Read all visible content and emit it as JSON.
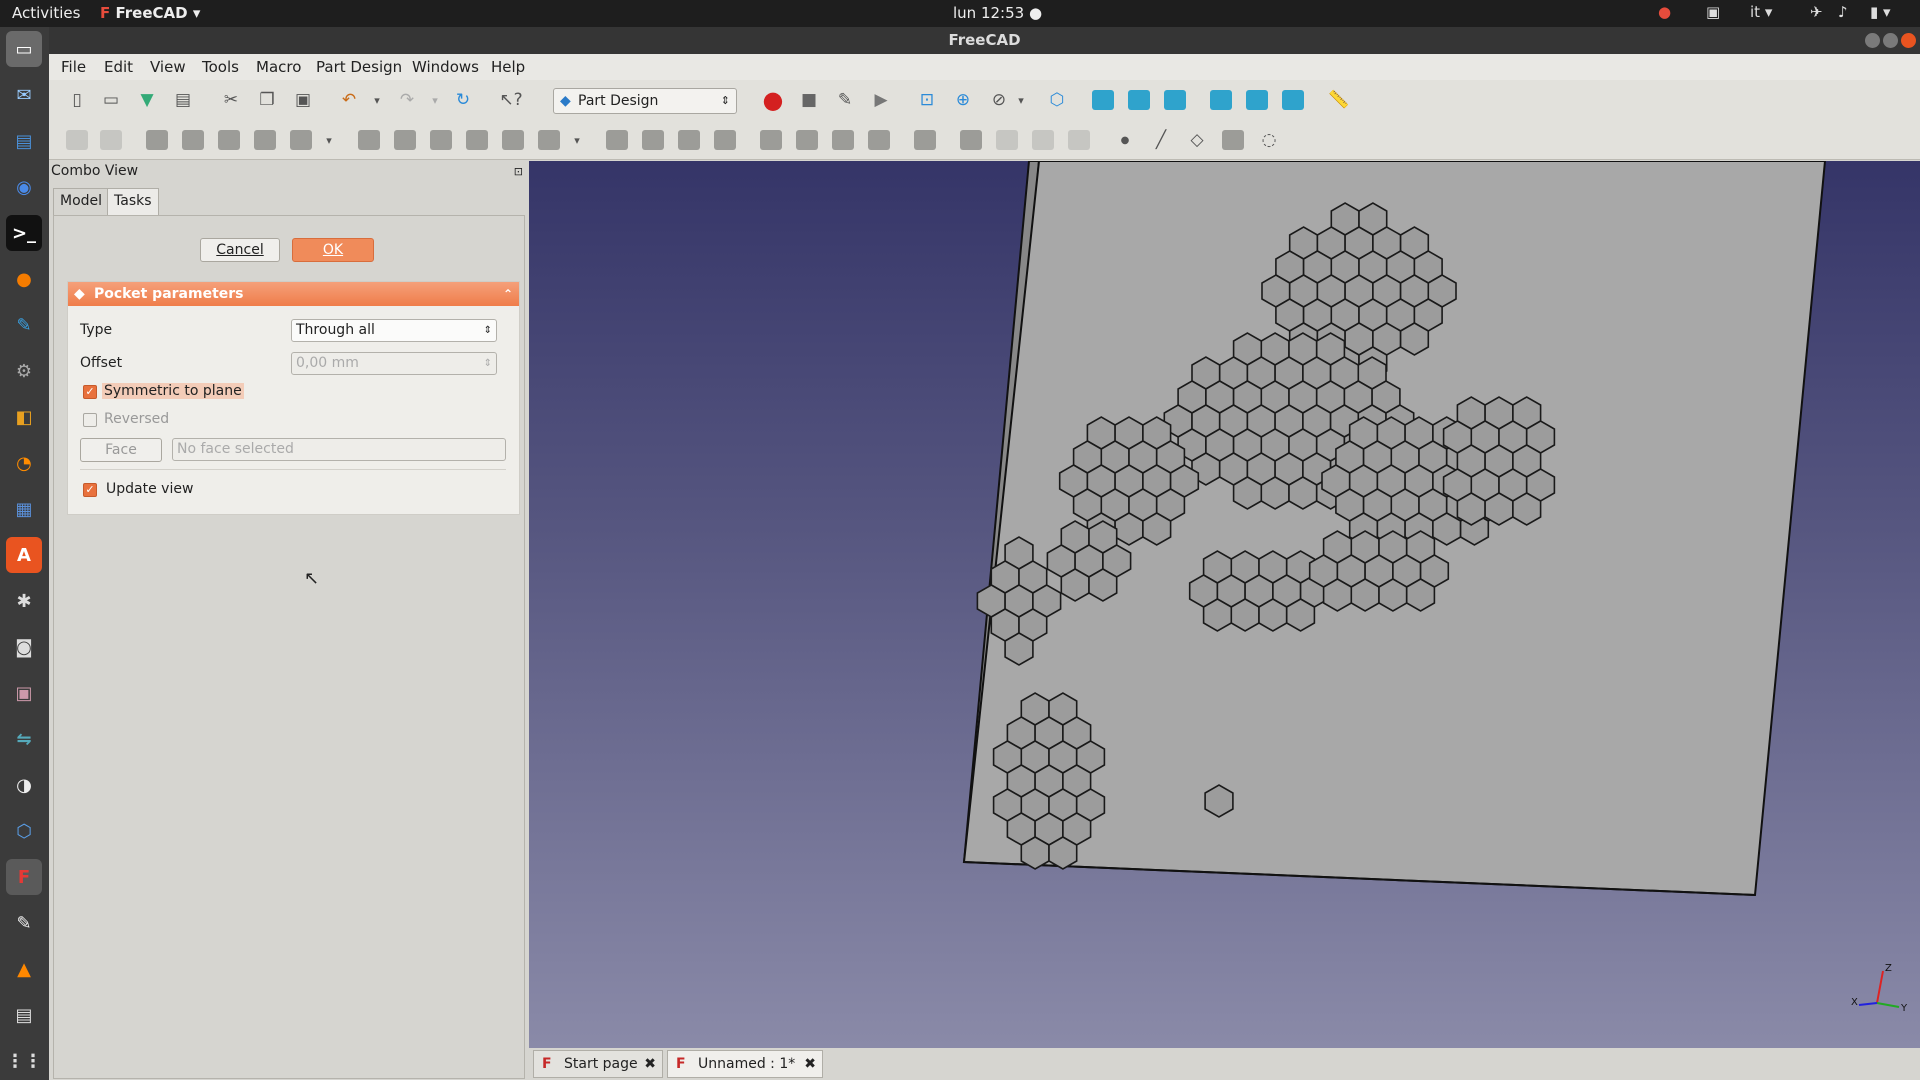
{
  "topbar": {
    "activities": "Activities",
    "app_name": "FreeCAD",
    "clock": "lun 12:53 ●",
    "lang": "it"
  },
  "window": {
    "title": "FreeCAD"
  },
  "menu": [
    "File",
    "Edit",
    "View",
    "Tools",
    "Macro",
    "Part Design",
    "Windows",
    "Help"
  ],
  "toolbar": {
    "workbench": "Part Design"
  },
  "combo": {
    "title": "Combo View",
    "tabs": [
      "Model",
      "Tasks"
    ],
    "cancel": "Cancel",
    "ok": "OK"
  },
  "pocket": {
    "header": "Pocket parameters",
    "type_label": "Type",
    "type_value": "Through all",
    "offset_label": "Offset",
    "offset_value": "0,00 mm",
    "symmetric": "Symmetric to plane",
    "reversed": "Reversed",
    "face_btn": "Face",
    "face_placeholder": "No face selected",
    "update_view": "Update view"
  },
  "doctabs": {
    "start": "Start page",
    "unnamed": "Unnamed : 1*"
  },
  "axis": {
    "x": "X",
    "y": "Y",
    "z": "Z"
  },
  "colors": {
    "accent": "#ef7d4a",
    "plate": "#a8a8a8",
    "view_top": "#353568",
    "view_bottom": "#8a8aa8"
  }
}
